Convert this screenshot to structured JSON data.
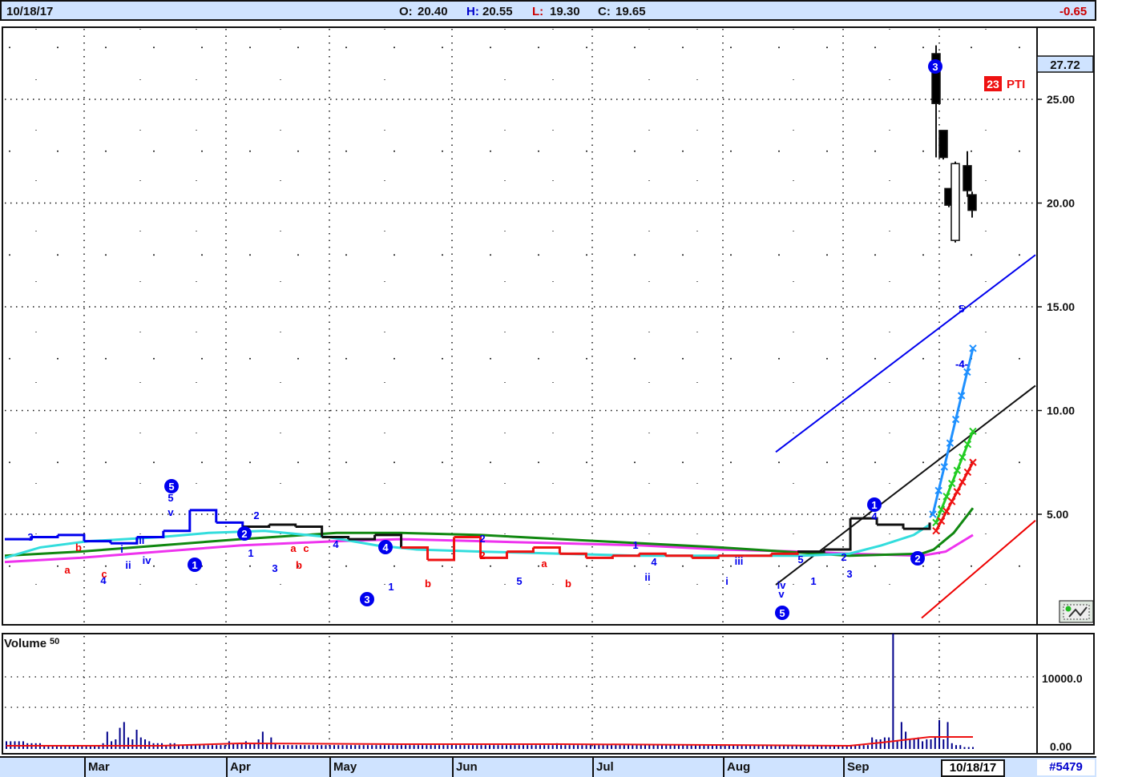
{
  "header": {
    "date": "10/18/17",
    "open_label": "O:",
    "open": "20.40",
    "high_label": "H:",
    "high": "20.55",
    "low_label": "L:",
    "low": "19.30",
    "close_label": "C:",
    "close": "19.65",
    "change": "-0.65"
  },
  "footer": {
    "months": [
      "Mar",
      "Apr",
      "May",
      "Jun",
      "Jul",
      "Aug",
      "Sep"
    ],
    "current_date": "10/18/17",
    "chart_id": "#5479"
  },
  "colors": {
    "up_candle": "#ffffff",
    "down_candle": "#000000",
    "blue_trend": "#0000ee",
    "red_trend": "#ee0000",
    "ma_cyan": "#33dddd",
    "ma_green": "#118811",
    "ma_magenta": "#ee33ee",
    "price_red": "#ee1111",
    "header_bg": "#cfe3ff"
  },
  "chart_data": [
    {
      "type": "candlestick",
      "ylim": [
        0,
        28.5
      ],
      "yticks": [
        5,
        10,
        15,
        20,
        25
      ],
      "ytick_labels": [
        "5.00",
        "10.00",
        "15.00",
        "20.00",
        "25.00"
      ],
      "last_price_label": "27.72",
      "ticker_badge": "23",
      "ticker": "PTI",
      "candles_late": [
        {
          "o": 27.2,
          "h": 27.6,
          "l": 22.2,
          "c": 24.8
        },
        {
          "o": 23.5,
          "h": 23.5,
          "l": 22.1,
          "c": 22.2
        },
        {
          "o": 20.7,
          "h": 20.7,
          "l": 19.8,
          "c": 19.9
        },
        {
          "o": 18.2,
          "h": 22.0,
          "l": 18.1,
          "c": 21.9
        },
        {
          "o": 21.8,
          "h": 22.5,
          "l": 20.3,
          "c": 20.6
        },
        {
          "o": 20.4,
          "h": 20.55,
          "l": 19.3,
          "c": 19.65
        }
      ],
      "price_pre_run": [
        3.8,
        3.9,
        4.0,
        3.7,
        3.6,
        3.9,
        4.2,
        5.2,
        4.6,
        4.4,
        4.5,
        4.4,
        3.9,
        3.8,
        4.0,
        3.4,
        2.8,
        3.9,
        2.9,
        3.2,
        3.4,
        3.1,
        2.9,
        3.0,
        3.1,
        3.0,
        2.9,
        3.0,
        3.0,
        3.1,
        3.2,
        3.3,
        4.8,
        4.5,
        4.3,
        4.6
      ],
      "moving_averages": [
        "cyan",
        "green",
        "magenta"
      ],
      "wave_labels_circled": [
        "5",
        "1",
        "2",
        "3",
        "4",
        "5",
        "1",
        "2",
        "3"
      ],
      "wave_labels_blue": [
        "3",
        "4",
        "ii",
        "i",
        "iii",
        "iv",
        "5",
        "v",
        "2",
        "1",
        "3",
        "4",
        "1",
        "2",
        "5",
        "1",
        "4",
        "ii",
        "i",
        "iii",
        "iv",
        "v",
        "5",
        "1",
        "2",
        "3",
        "4",
        "5",
        "-4-",
        "-4-"
      ],
      "wave_labels_red": [
        "a",
        "b",
        "c",
        "a",
        "b",
        "c",
        "2",
        "a",
        "b",
        "b"
      ]
    },
    {
      "type": "bar",
      "title": "Volume",
      "subtitle": "50",
      "yticks": [
        0,
        10000
      ],
      "ytick_labels": [
        "0.00",
        "10000.0"
      ],
      "values_relative": [
        4,
        4,
        4,
        4,
        4,
        3,
        3,
        3,
        3,
        2,
        2,
        2,
        2,
        2,
        2,
        2,
        2,
        2,
        2,
        2,
        2,
        2,
        2,
        3,
        9,
        4,
        5,
        11,
        14,
        6,
        5,
        10,
        6,
        5,
        4,
        3,
        3,
        3,
        2,
        3,
        3,
        2,
        2,
        2,
        2,
        2,
        2,
        2,
        2,
        2,
        2,
        2,
        2,
        4,
        3,
        3,
        3,
        4,
        3,
        3,
        5,
        9,
        3,
        6,
        3,
        2,
        2,
        2,
        2,
        2,
        2,
        2,
        2,
        2,
        2,
        2,
        2,
        2,
        2,
        2,
        2,
        2,
        2,
        2,
        2,
        2,
        2,
        2,
        2,
        2,
        2,
        2,
        2,
        2,
        2,
        2,
        2,
        2,
        2,
        2,
        2,
        2,
        2,
        2,
        2,
        2,
        2,
        2,
        2,
        2,
        2,
        2,
        2,
        2,
        2,
        2,
        2,
        2,
        2,
        2,
        2,
        2,
        2,
        2,
        2,
        2,
        2,
        2,
        2,
        2,
        2,
        3,
        2,
        2,
        2,
        2,
        2,
        2,
        2,
        2,
        2,
        2,
        2,
        2,
        2,
        2,
        2,
        2,
        2,
        2,
        2,
        2,
        2,
        2,
        2,
        2,
        2,
        2,
        2,
        2,
        2,
        2,
        2,
        2,
        2,
        2,
        2,
        2,
        2,
        2,
        2,
        2,
        2,
        2,
        2,
        2,
        2,
        2,
        2,
        2,
        2,
        2,
        2,
        2,
        2,
        2,
        2,
        2,
        2,
        2,
        2,
        2,
        2,
        2,
        2,
        2,
        2,
        2,
        2,
        2,
        2,
        2,
        2,
        2,
        2,
        2,
        6,
        5,
        5,
        6,
        6,
        60,
        4,
        14,
        9,
        5,
        5,
        6,
        4,
        5,
        5,
        6,
        15,
        5,
        14,
        3,
        2,
        2,
        1,
        1,
        1
      ]
    }
  ]
}
